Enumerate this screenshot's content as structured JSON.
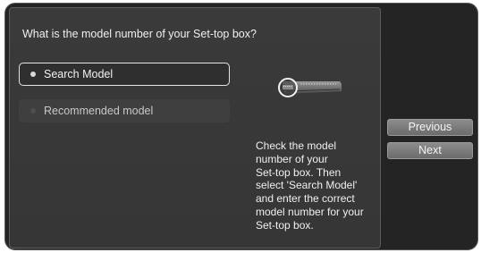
{
  "question": "What is the model number of your Set-top box?",
  "options": [
    {
      "label": "Search Model",
      "selected": true
    },
    {
      "label": "Recommended model",
      "selected": false
    }
  ],
  "help_text": "Check the model\nnumber of your\nSet-top box. Then\nselect 'Search Model'\nand enter the correct\nmodel number for your\nSet-top box.",
  "buttons": {
    "previous": "Previous",
    "next": "Next"
  },
  "icons": {
    "device": "set-top-box-icon"
  },
  "colors": {
    "background": "#242424",
    "panel": "#383838",
    "button": "#7c7c7c",
    "focus_border": "#e4e4e4",
    "text": "#f0f0f0"
  }
}
